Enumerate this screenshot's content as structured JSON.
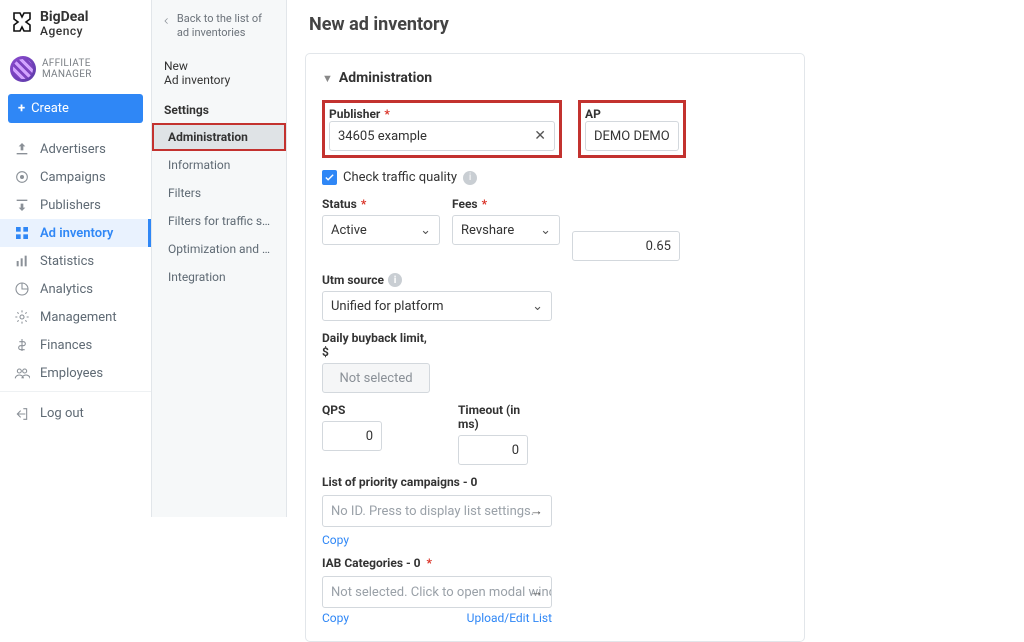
{
  "brand": {
    "line1": "BigDeal",
    "line2": "Agency"
  },
  "role": "AFFILIATE MANAGER",
  "create_label": "Create",
  "nav": [
    {
      "icon": "upload",
      "label": "Advertisers",
      "active": false
    },
    {
      "icon": "target",
      "label": "Campaigns",
      "active": false
    },
    {
      "icon": "download",
      "label": "Publishers",
      "active": false
    },
    {
      "icon": "grid",
      "label": "Ad inventory",
      "active": true
    },
    {
      "icon": "stats",
      "label": "Statistics",
      "active": false
    },
    {
      "icon": "analytics",
      "label": "Analytics",
      "active": false
    },
    {
      "icon": "gear",
      "label": "Management",
      "active": false
    },
    {
      "icon": "dollar",
      "label": "Finances",
      "active": false
    },
    {
      "icon": "people",
      "label": "Employees",
      "active": false
    }
  ],
  "logout_label": "Log out",
  "backlink": "Back to the list of ad inventories",
  "settings": {
    "new": "New",
    "sub": "Ad inventory",
    "title": "Settings",
    "items": [
      {
        "label": "Administration",
        "active": true
      },
      {
        "label": "Information"
      },
      {
        "label": "Filters"
      },
      {
        "label": "Filters for traffic sour..."
      },
      {
        "label": "Optimization and rules"
      },
      {
        "label": "Integration"
      }
    ]
  },
  "page_title": "New ad inventory",
  "section_title": "Administration",
  "publisher_label": "Publisher",
  "publisher_value": "34605 example",
  "ap_label": "AP",
  "ap_value": "DEMO DEMO",
  "check_traffic_label": "Check traffic quality",
  "status_label": "Status",
  "status_value": "Active",
  "fees_label": "Fees",
  "fees_value": "Revshare",
  "fees_amount": "0.65",
  "utm_label": "Utm source",
  "utm_value": "Unified for platform",
  "daily_label": "Daily buyback limit, $",
  "daily_value": "Not selected",
  "qps_label": "QPS",
  "qps_value": "0",
  "timeout_label": "Timeout (in ms)",
  "timeout_value": "0",
  "priority_label": "List of priority campaigns - 0",
  "priority_placeholder": "No ID. Press to display list settings.",
  "iab_label_prefix": "IAB Categories - 0",
  "iab_placeholder": "Not selected. Click to open modal window wi...",
  "copy_label": "Copy",
  "upload_label": "Upload/Edit List"
}
